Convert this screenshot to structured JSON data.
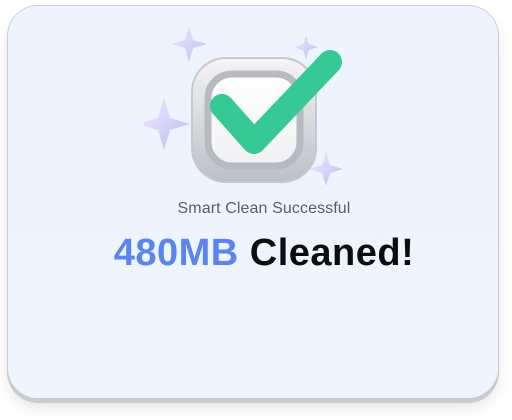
{
  "success_dialog": {
    "subtitle": "Smart Clean Successful",
    "amount": "480MB",
    "headline_suffix": "Cleaned!",
    "icon": "checkmark-badge-icon"
  },
  "colors": {
    "background": "#eef4fe",
    "amount_accent": "#5c84ef",
    "check": "#36c995",
    "headline_text": "#0b0d10",
    "subtitle_text": "#5a5d63"
  }
}
